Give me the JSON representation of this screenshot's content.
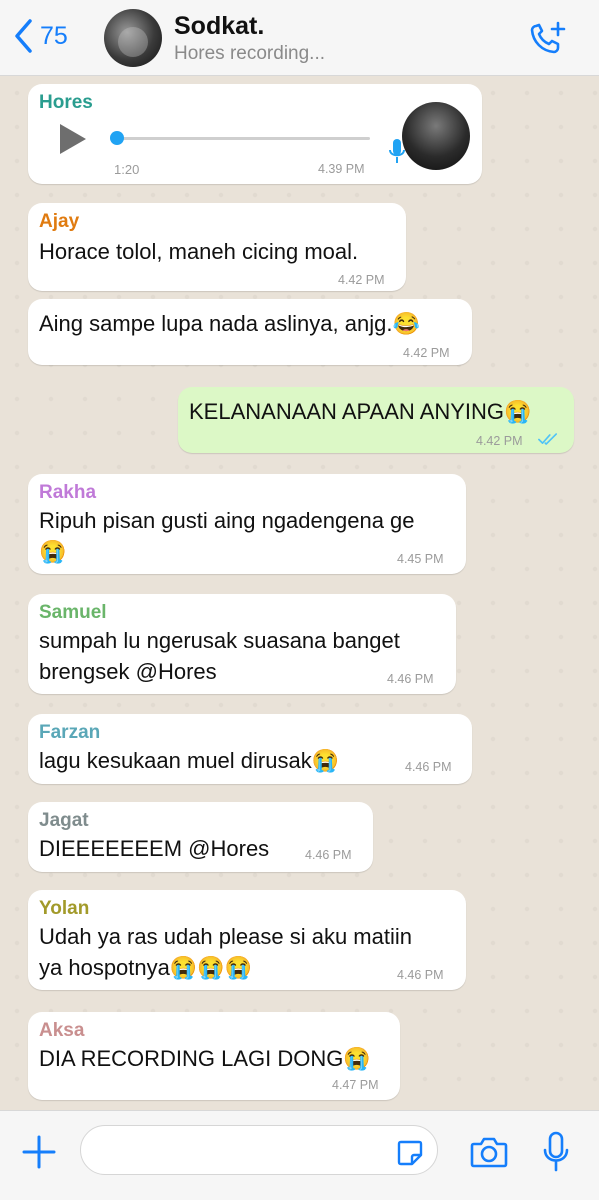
{
  "header": {
    "back_count": "75",
    "title": "Sodkat.",
    "subtitle": "Hores recording..."
  },
  "colors": {
    "accent": "#157efb",
    "outgoing_bubble": "#dcf8c6",
    "incoming_bubble": "#ffffff",
    "read_ticks": "#4fc3f7",
    "voice_progress": "#21a3f3"
  },
  "messages": [
    {
      "sender": "Hores",
      "sender_color": "#2a9d8f",
      "type": "voice",
      "duration": "1:20",
      "time": "4.39 PM"
    },
    {
      "sender": "Ajay",
      "sender_color": "#e07b10",
      "text": "Horace tolol, maneh cicing moal.",
      "time": "4.42 PM"
    },
    {
      "text": "Aing sampe lupa nada aslinya, anjg.😂",
      "time": "4.42 PM"
    },
    {
      "type": "outgoing",
      "text": "KELANANAAN APAAN ANYING😭",
      "time": "4.42 PM",
      "status_icon": "double-check-icon"
    },
    {
      "sender": "Rakha",
      "sender_color": "#c07ad8",
      "lines": [
        "Ripuh pisan gusti aing ngadengena ge",
        "😭"
      ],
      "time": "4.45 PM"
    },
    {
      "sender": "Samuel",
      "sender_color": "#6ab56a",
      "lines": [
        "sumpah lu ngerusak suasana banget",
        "brengsek @Hores"
      ],
      "time": "4.46 PM"
    },
    {
      "sender": "Farzan",
      "sender_color": "#5aa7b7",
      "text": "lagu kesukaan muel dirusak😭",
      "time": "4.46 PM"
    },
    {
      "sender": "Jagat",
      "sender_color": "#7f8c8d",
      "text": "DIEEEEEEEM @Hores",
      "time": "4.46 PM"
    },
    {
      "sender": "Yolan",
      "sender_color": "#a29a2a",
      "lines": [
        "Udah ya ras udah please si aku matiin",
        "ya hospotnya😭😭😭"
      ],
      "time": "4.46 PM"
    },
    {
      "sender": "Aksa",
      "sender_color": "#c98f8f",
      "text": "DIA RECORDING LAGI DONG😭",
      "time": "4.47 PM"
    }
  ],
  "input": {
    "placeholder": ""
  },
  "icons": [
    "chevron-left-icon",
    "call-add-icon",
    "play-icon",
    "mic-icon",
    "plus-icon",
    "sticker-icon",
    "camera-icon"
  ]
}
